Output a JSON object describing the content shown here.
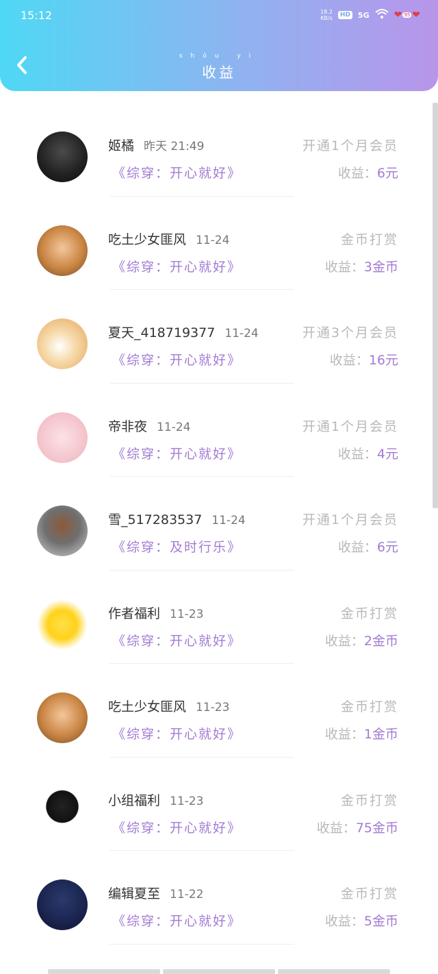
{
  "status_bar": {
    "time": "15:12",
    "net_speed_top": "18.2",
    "net_speed_bottom": "KB/s",
    "hd": "HD",
    "signal": "5G",
    "battery": "95"
  },
  "header": {
    "title": "收益",
    "title_pinyin": "shōu yì"
  },
  "entries": [
    {
      "name": "姬橘",
      "date": "昨天 21:49",
      "book": "《综穿：开心就好》",
      "action": "开通1个月会员",
      "earn_label": "收益：",
      "earn_value": "6元"
    },
    {
      "name": "吃土少女匪风",
      "date": "11-24",
      "book": "《综穿：开心就好》",
      "action": "金币打赏",
      "earn_label": "收益：",
      "earn_value": "3金币"
    },
    {
      "name": "夏天_418719377",
      "date": "11-24",
      "book": "《综穿：开心就好》",
      "action": "开通3个月会员",
      "earn_label": "收益：",
      "earn_value": "16元"
    },
    {
      "name": "帝非夜",
      "date": "11-24",
      "book": "《综穿：开心就好》",
      "action": "开通1个月会员",
      "earn_label": "收益：",
      "earn_value": "4元"
    },
    {
      "name": "雪_517283537",
      "date": "11-24",
      "book": "《综穿：及时行乐》",
      "action": "开通1个月会员",
      "earn_label": "收益：",
      "earn_value": "6元"
    },
    {
      "name": "作者福利",
      "date": "11-23",
      "book": "《综穿：开心就好》",
      "action": "金币打赏",
      "earn_label": "收益：",
      "earn_value": "2金币"
    },
    {
      "name": "吃土少女匪风",
      "date": "11-23",
      "book": "《综穿：开心就好》",
      "action": "金币打赏",
      "earn_label": "收益：",
      "earn_value": "1金币"
    },
    {
      "name": "小组福利",
      "date": "11-23",
      "book": "《综穿：开心就好》",
      "action": "金币打赏",
      "earn_label": "收益：",
      "earn_value": "75金币"
    },
    {
      "name": "编辑夏至",
      "date": "11-22",
      "book": "《综穿：开心就好》",
      "action": "金币打赏",
      "earn_label": "收益：",
      "earn_value": "5金币"
    }
  ],
  "colors": {
    "accent": "#a27bd3",
    "header_start": "#4fd8f5",
    "header_end": "#b895ea",
    "muted": "#b8b8b8"
  }
}
